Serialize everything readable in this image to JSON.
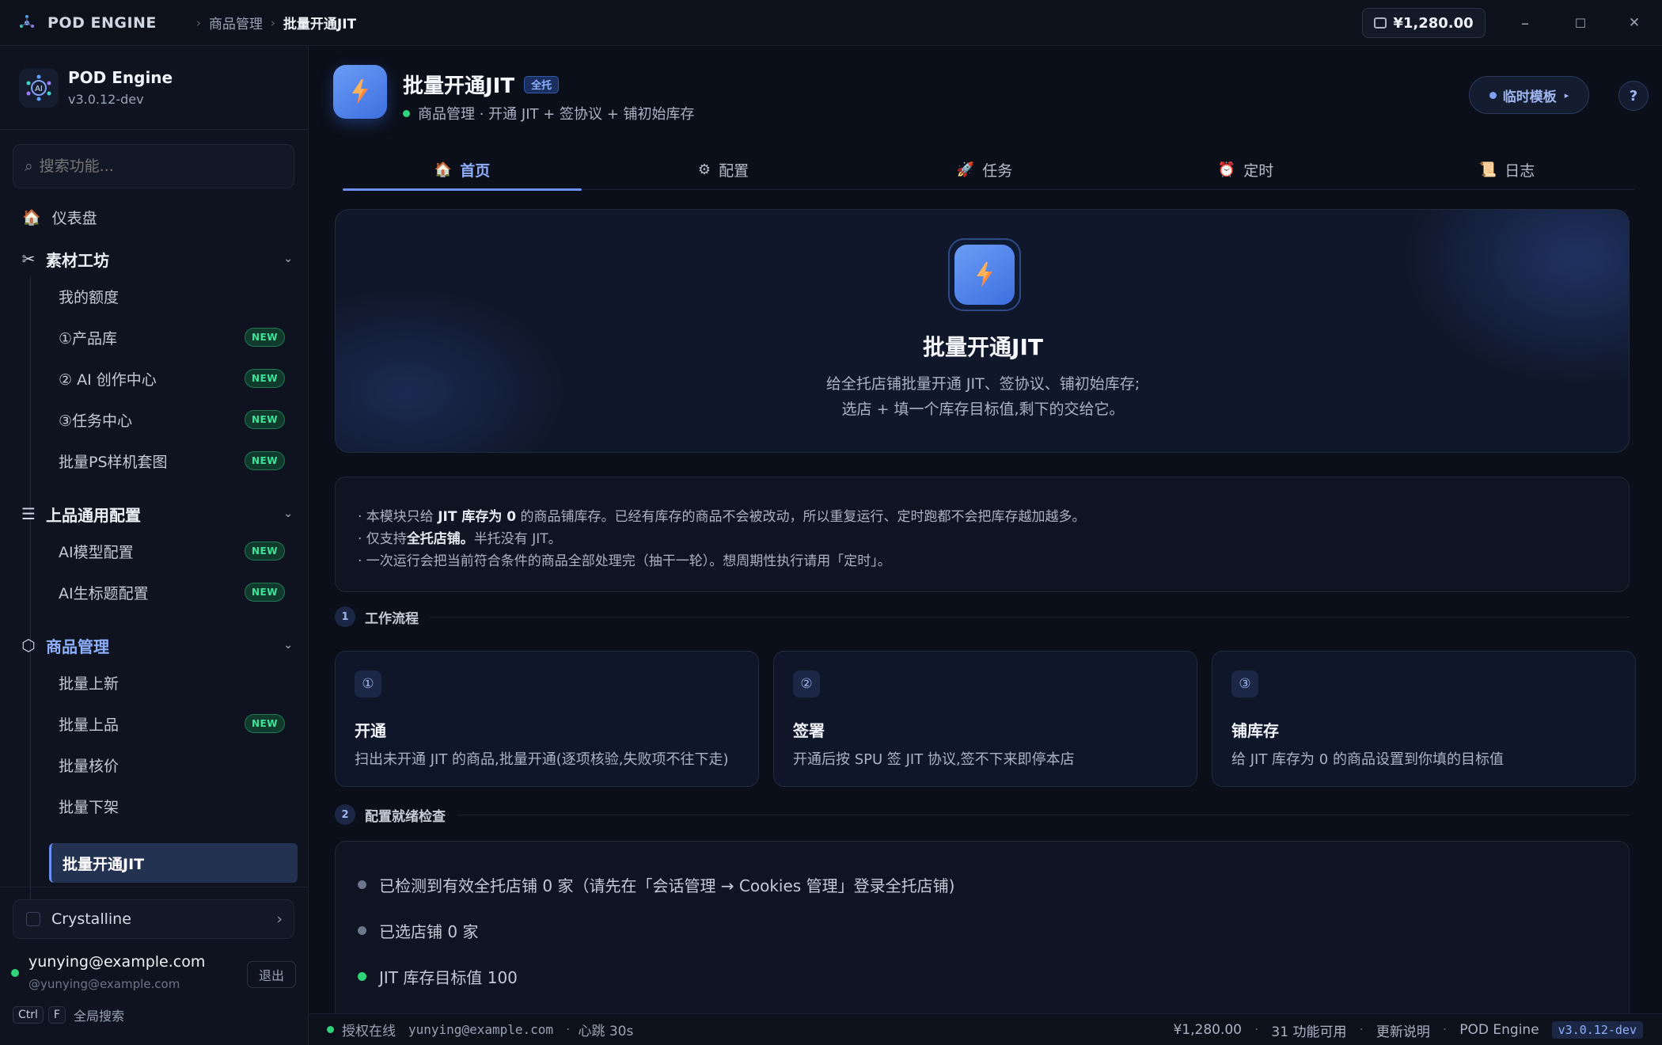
{
  "titlebar": {
    "app_name": "POD ENGINE",
    "breadcrumb": [
      "商品管理",
      "批量开通JIT"
    ],
    "wallet": "¥1,280.00",
    "minimize": "–",
    "maximize": "☐",
    "close": "✕"
  },
  "sidebar": {
    "app_name": "POD Engine",
    "version": "v3.0.12-dev",
    "search_placeholder": "搜索功能...",
    "dashboard": "仪表盘",
    "sections": [
      {
        "label": "素材工坊",
        "items": [
          {
            "label": "我的额度",
            "new": false
          },
          {
            "label": "①产品库",
            "new": true
          },
          {
            "label": "② AI 创作中心",
            "new": true
          },
          {
            "label": "③任务中心",
            "new": true
          },
          {
            "label": "批量PS样机套图",
            "new": true
          }
        ]
      },
      {
        "label": "上品通用配置",
        "items": [
          {
            "label": "AI模型配置",
            "new": true
          },
          {
            "label": "AI生标题配置",
            "new": true
          }
        ]
      },
      {
        "label": "商品管理",
        "items": [
          {
            "label": "批量上新",
            "new": false
          },
          {
            "label": "批量上品",
            "new": true
          },
          {
            "label": "批量核价",
            "new": false
          },
          {
            "label": "批量下架",
            "new": false
          },
          {
            "label": "批量开通JIT",
            "new": false,
            "active": true
          }
        ]
      }
    ],
    "new_badge": "NEW",
    "theme": "Crystalline",
    "user_email": "yunying@example.com",
    "user_handle": "@yunying@example.com",
    "logout": "退出",
    "kbd_ctrl": "Ctrl",
    "kbd_f": "F",
    "kbd_hint": "全局搜索"
  },
  "header": {
    "title": "批量开通JIT",
    "tag": "全托",
    "subtitle": "商品管理 · 开通 JIT + 签协议 + 铺初始库存",
    "template_button": "临时模板",
    "help": "?"
  },
  "tabs": [
    {
      "label": "首页",
      "icon": "🏠",
      "active": true
    },
    {
      "label": "配置",
      "icon": "⚙",
      "active": false
    },
    {
      "label": "任务",
      "icon": "🚀",
      "active": false
    },
    {
      "label": "定时",
      "icon": "⏰",
      "active": false
    },
    {
      "label": "日志",
      "icon": "📜",
      "active": false
    }
  ],
  "hero": {
    "title": "批量开通JIT",
    "line1": "给全托店铺批量开通 JIT、签协议、铺初始库存;",
    "line2": "选店 + 填一个库存目标值,剩下的交给它。"
  },
  "notes": {
    "n1_pre": "· 本模块只给 ",
    "n1_bold": "JIT 库存为 0",
    "n1_post": " 的商品铺库存。已经有库存的商品不会被改动，所以重复运行、定时跑都不会把库存越加越多。",
    "n2_pre": "· 仅支持",
    "n2_bold": "全托店铺。",
    "n2_post": "半托没有 JIT。",
    "n3": "· 一次运行会把当前符合条件的商品全部处理完（抽干一轮）。想周期性执行请用「定时」。"
  },
  "workflow": {
    "num": "1",
    "title": "工作流程",
    "steps": [
      {
        "icon": "①",
        "title": "开通",
        "desc": "扫出未开通 JIT 的商品,批量开通(逐项核验,失败项不往下走)"
      },
      {
        "icon": "②",
        "title": "签署",
        "desc": "开通后按 SPU 签 JIT 协议,签不下来即停本店"
      },
      {
        "icon": "③",
        "title": "铺库存",
        "desc": "给 JIT 库存为 0 的商品设置到你填的目标值"
      }
    ]
  },
  "readiness": {
    "num": "2",
    "title": "配置就绪检查",
    "items": [
      {
        "text": "已检测到有效全托店铺 0 家（请先在「会话管理 → Cookies 管理」登录全托店铺)",
        "ok": false
      },
      {
        "text": "已选店铺 0 家",
        "ok": false
      },
      {
        "text": "JIT 库存目标值 100",
        "ok": true
      }
    ]
  },
  "statusbar": {
    "auth": "授权在线",
    "user": "yunying@example.com",
    "heartbeat": "心跳 30s",
    "balance": "¥1,280.00",
    "features": "31 功能可用",
    "changelog": "更新说明",
    "app": "POD Engine",
    "version": "v3.0.12-dev"
  }
}
